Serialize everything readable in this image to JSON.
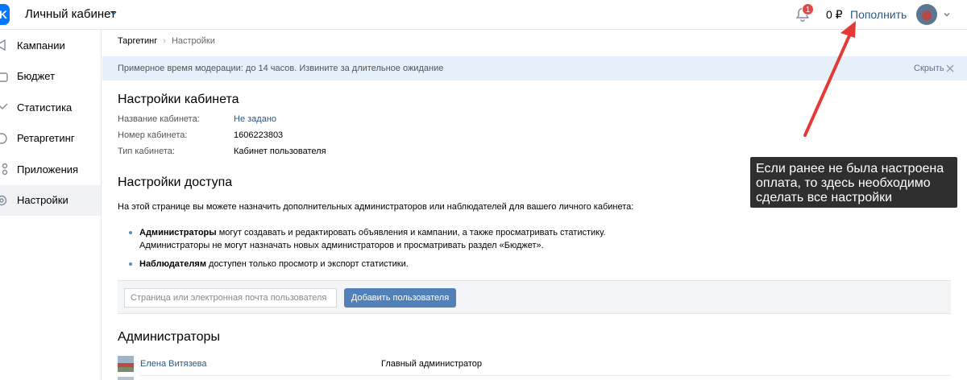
{
  "header": {
    "logo": "K",
    "title": "Личный кабинет",
    "notifications_count": "1",
    "balance": "0 ₽",
    "topup_label": "Пополнить"
  },
  "sidebar": {
    "items": [
      {
        "label": "Кампании",
        "icon": "megaphone-icon"
      },
      {
        "label": "Бюджет",
        "icon": "wallet-icon"
      },
      {
        "label": "Статистика",
        "icon": "chart-icon"
      },
      {
        "label": "Ретаргетинг",
        "icon": "target-icon"
      },
      {
        "label": "Приложения",
        "icon": "apps-icon"
      },
      {
        "label": "Настройки",
        "icon": "gear-icon",
        "active": true
      }
    ]
  },
  "breadcrumb": {
    "first": "Таргетинг",
    "separator": "›",
    "second": "Настройки"
  },
  "notice": {
    "text": "Примерное время модерации: до 14 часов. Извините за длительное ожидание",
    "hide_label": "Скрыть"
  },
  "cabinet_settings": {
    "title": "Настройки кабинета",
    "name_label": "Название кабинета:",
    "name_value": "Не задано",
    "number_label": "Номер кабинета:",
    "number_value": "1606223803",
    "type_label": "Тип кабинета:",
    "type_value": "Кабинет пользователя"
  },
  "access_settings": {
    "title": "Настройки доступа",
    "description": "На этой странице вы можете назначить дополнительных администраторов или наблюдателей для вашего личного кабинета:",
    "admins_bold": "Администраторы",
    "admins_text": " могут создавать и редактировать объявления и кампании, а также просматривать статистику.",
    "admins_text2": "Администраторы не могут назначать новых администраторов и просматривать раздел «Бюджет».",
    "observers_bold": "Наблюдателям",
    "observers_text": " доступен только просмотр и экспорт статистики.",
    "input_placeholder": "Страница или электронная почта пользователя",
    "input_value": "",
    "add_button_label": "Добавить пользователя"
  },
  "administrators": {
    "title": "Администраторы",
    "rows": [
      {
        "name": "Елена Витязева",
        "role": "Главный администратор"
      }
    ]
  },
  "annotation": {
    "line1": "Если ранее не была настроена",
    "line2": "оплата, то здесь необходимо",
    "line3": "сделать все настройки",
    "color": "#e53935"
  }
}
